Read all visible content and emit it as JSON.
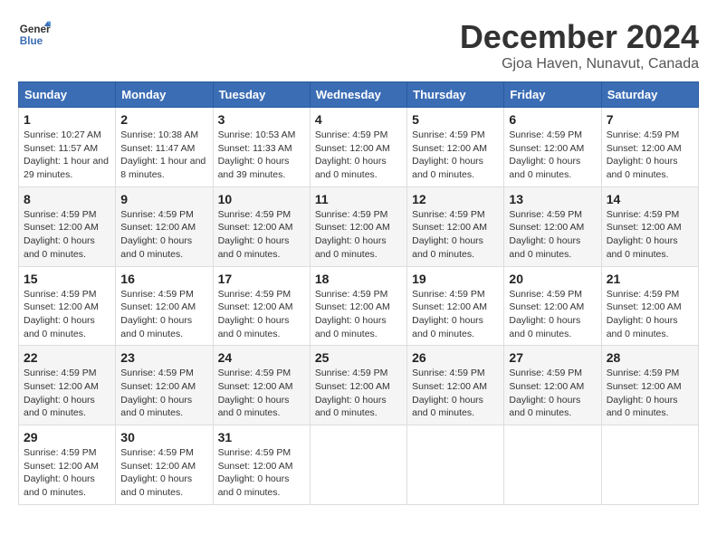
{
  "header": {
    "logo_line1": "General",
    "logo_line2": "Blue",
    "month": "December 2024",
    "location": "Gjoa Haven, Nunavut, Canada"
  },
  "weekdays": [
    "Sunday",
    "Monday",
    "Tuesday",
    "Wednesday",
    "Thursday",
    "Friday",
    "Saturday"
  ],
  "weeks": [
    [
      {
        "day": "1",
        "sunrise": "Sunrise: 10:27 AM",
        "sunset": "Sunset: 11:57 AM",
        "daylight": "Daylight: 1 hour and 29 minutes."
      },
      {
        "day": "2",
        "sunrise": "Sunrise: 10:38 AM",
        "sunset": "Sunset: 11:47 AM",
        "daylight": "Daylight: 1 hour and 8 minutes."
      },
      {
        "day": "3",
        "sunrise": "Sunrise: 10:53 AM",
        "sunset": "Sunset: 11:33 AM",
        "daylight": "Daylight: 0 hours and 39 minutes."
      },
      {
        "day": "4",
        "sunrise": "Sunrise: 4:59 PM",
        "sunset": "Sunset: 12:00 AM",
        "daylight": "Daylight: 0 hours and 0 minutes."
      },
      {
        "day": "5",
        "sunrise": "Sunrise: 4:59 PM",
        "sunset": "Sunset: 12:00 AM",
        "daylight": "Daylight: 0 hours and 0 minutes."
      },
      {
        "day": "6",
        "sunrise": "Sunrise: 4:59 PM",
        "sunset": "Sunset: 12:00 AM",
        "daylight": "Daylight: 0 hours and 0 minutes."
      },
      {
        "day": "7",
        "sunrise": "Sunrise: 4:59 PM",
        "sunset": "Sunset: 12:00 AM",
        "daylight": "Daylight: 0 hours and 0 minutes."
      }
    ],
    [
      {
        "day": "8",
        "sunrise": "Sunrise: 4:59 PM",
        "sunset": "Sunset: 12:00 AM",
        "daylight": "Daylight: 0 hours and 0 minutes."
      },
      {
        "day": "9",
        "sunrise": "Sunrise: 4:59 PM",
        "sunset": "Sunset: 12:00 AM",
        "daylight": "Daylight: 0 hours and 0 minutes."
      },
      {
        "day": "10",
        "sunrise": "Sunrise: 4:59 PM",
        "sunset": "Sunset: 12:00 AM",
        "daylight": "Daylight: 0 hours and 0 minutes."
      },
      {
        "day": "11",
        "sunrise": "Sunrise: 4:59 PM",
        "sunset": "Sunset: 12:00 AM",
        "daylight": "Daylight: 0 hours and 0 minutes."
      },
      {
        "day": "12",
        "sunrise": "Sunrise: 4:59 PM",
        "sunset": "Sunset: 12:00 AM",
        "daylight": "Daylight: 0 hours and 0 minutes."
      },
      {
        "day": "13",
        "sunrise": "Sunrise: 4:59 PM",
        "sunset": "Sunset: 12:00 AM",
        "daylight": "Daylight: 0 hours and 0 minutes."
      },
      {
        "day": "14",
        "sunrise": "Sunrise: 4:59 PM",
        "sunset": "Sunset: 12:00 AM",
        "daylight": "Daylight: 0 hours and 0 minutes."
      }
    ],
    [
      {
        "day": "15",
        "sunrise": "Sunrise: 4:59 PM",
        "sunset": "Sunset: 12:00 AM",
        "daylight": "Daylight: 0 hours and 0 minutes."
      },
      {
        "day": "16",
        "sunrise": "Sunrise: 4:59 PM",
        "sunset": "Sunset: 12:00 AM",
        "daylight": "Daylight: 0 hours and 0 minutes."
      },
      {
        "day": "17",
        "sunrise": "Sunrise: 4:59 PM",
        "sunset": "Sunset: 12:00 AM",
        "daylight": "Daylight: 0 hours and 0 minutes."
      },
      {
        "day": "18",
        "sunrise": "Sunrise: 4:59 PM",
        "sunset": "Sunset: 12:00 AM",
        "daylight": "Daylight: 0 hours and 0 minutes."
      },
      {
        "day": "19",
        "sunrise": "Sunrise: 4:59 PM",
        "sunset": "Sunset: 12:00 AM",
        "daylight": "Daylight: 0 hours and 0 minutes."
      },
      {
        "day": "20",
        "sunrise": "Sunrise: 4:59 PM",
        "sunset": "Sunset: 12:00 AM",
        "daylight": "Daylight: 0 hours and 0 minutes."
      },
      {
        "day": "21",
        "sunrise": "Sunrise: 4:59 PM",
        "sunset": "Sunset: 12:00 AM",
        "daylight": "Daylight: 0 hours and 0 minutes."
      }
    ],
    [
      {
        "day": "22",
        "sunrise": "Sunrise: 4:59 PM",
        "sunset": "Sunset: 12:00 AM",
        "daylight": "Daylight: 0 hours and 0 minutes."
      },
      {
        "day": "23",
        "sunrise": "Sunrise: 4:59 PM",
        "sunset": "Sunset: 12:00 AM",
        "daylight": "Daylight: 0 hours and 0 minutes."
      },
      {
        "day": "24",
        "sunrise": "Sunrise: 4:59 PM",
        "sunset": "Sunset: 12:00 AM",
        "daylight": "Daylight: 0 hours and 0 minutes."
      },
      {
        "day": "25",
        "sunrise": "Sunrise: 4:59 PM",
        "sunset": "Sunset: 12:00 AM",
        "daylight": "Daylight: 0 hours and 0 minutes."
      },
      {
        "day": "26",
        "sunrise": "Sunrise: 4:59 PM",
        "sunset": "Sunset: 12:00 AM",
        "daylight": "Daylight: 0 hours and 0 minutes."
      },
      {
        "day": "27",
        "sunrise": "Sunrise: 4:59 PM",
        "sunset": "Sunset: 12:00 AM",
        "daylight": "Daylight: 0 hours and 0 minutes."
      },
      {
        "day": "28",
        "sunrise": "Sunrise: 4:59 PM",
        "sunset": "Sunset: 12:00 AM",
        "daylight": "Daylight: 0 hours and 0 minutes."
      }
    ],
    [
      {
        "day": "29",
        "sunrise": "Sunrise: 4:59 PM",
        "sunset": "Sunset: 12:00 AM",
        "daylight": "Daylight: 0 hours and 0 minutes."
      },
      {
        "day": "30",
        "sunrise": "Sunrise: 4:59 PM",
        "sunset": "Sunset: 12:00 AM",
        "daylight": "Daylight: 0 hours and 0 minutes."
      },
      {
        "day": "31",
        "sunrise": "Sunrise: 4:59 PM",
        "sunset": "Sunset: 12:00 AM",
        "daylight": "Daylight: 0 hours and 0 minutes."
      },
      null,
      null,
      null,
      null
    ]
  ]
}
